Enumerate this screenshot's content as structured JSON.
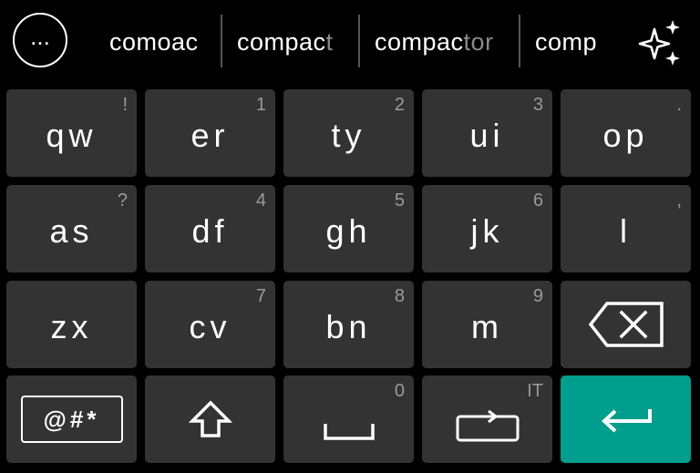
{
  "suggestions": {
    "more_label": "...",
    "items": [
      {
        "typed": "comoac",
        "rest": ""
      },
      {
        "typed": "compac",
        "rest": "t"
      },
      {
        "typed": "compac",
        "rest": "tor"
      },
      {
        "typed": "comp",
        "rest": ""
      }
    ]
  },
  "keyboard": {
    "rows": [
      [
        {
          "label": "qw",
          "hint": "!"
        },
        {
          "label": "er",
          "hint": "1"
        },
        {
          "label": "ty",
          "hint": "2"
        },
        {
          "label": "ui",
          "hint": "3"
        },
        {
          "label": "op",
          "hint": "."
        }
      ],
      [
        {
          "label": "as",
          "hint": "?"
        },
        {
          "label": "df",
          "hint": "4"
        },
        {
          "label": "gh",
          "hint": "5"
        },
        {
          "label": "jk",
          "hint": "6"
        },
        {
          "label": "l",
          "hint": ","
        }
      ],
      [
        {
          "label": "zx",
          "hint": ""
        },
        {
          "label": "cv",
          "hint": "7"
        },
        {
          "label": "bn",
          "hint": "8"
        },
        {
          "label": "m",
          "hint": "9"
        }
      ]
    ],
    "symbols_label": "@#*",
    "space_hint": "0",
    "switch_hint": "IT",
    "icons": {
      "backspace": "backspace-icon",
      "shift": "shift-arrow-icon",
      "space": "space-bar-icon",
      "switch": "switch-layout-icon",
      "enter": "enter-arrow-icon",
      "sparkle": "sparkle-icon"
    },
    "colors": {
      "key": "#333333",
      "enter": "#009e8c",
      "hint": "#9a9a9a"
    }
  }
}
